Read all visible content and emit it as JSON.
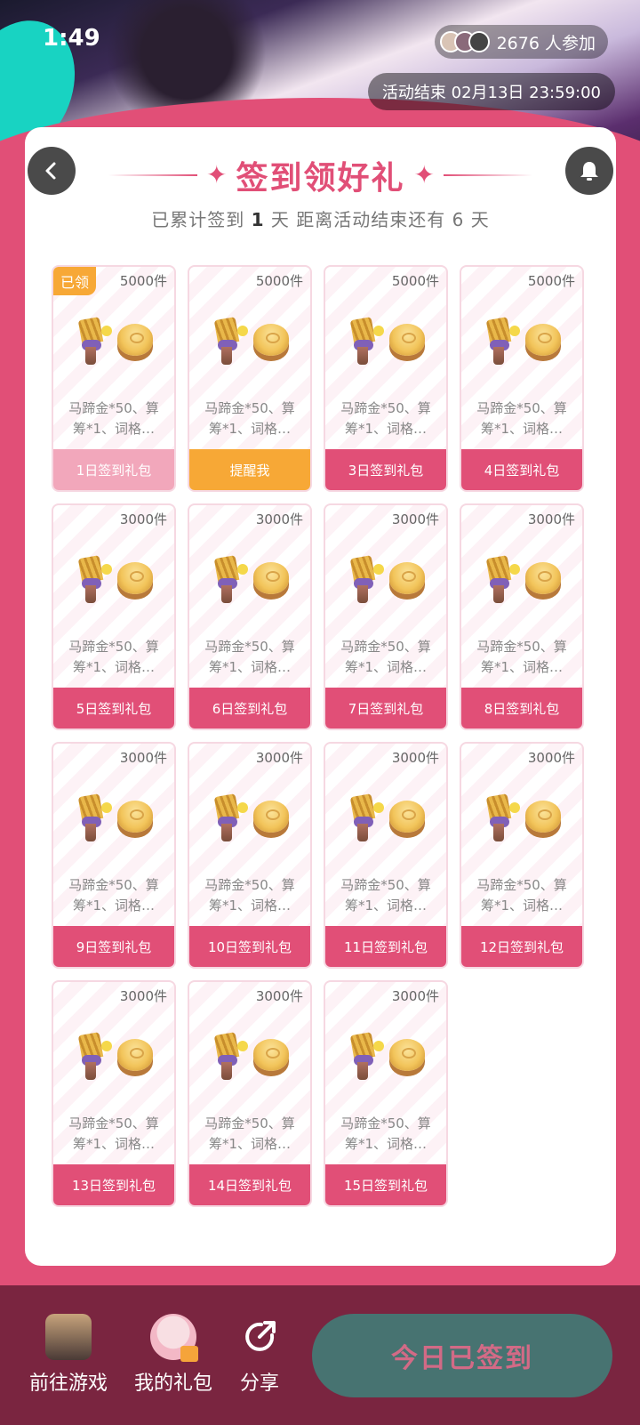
{
  "status": {
    "time": "1:49"
  },
  "header": {
    "participants": "2676 人参加",
    "deadline": "活动结束 02月13日 23:59:00"
  },
  "card": {
    "title": "签到领好礼",
    "summary_prefix": "已累计签到",
    "summary_days": "1",
    "summary_mid": "天  距离活动结束还有 6 天"
  },
  "gifts": [
    {
      "stock": "5000件",
      "desc": "马蹄金*50、算筹*1、词格…",
      "button": "1日签到礼包",
      "tag": "已领",
      "state": "claimed"
    },
    {
      "stock": "5000件",
      "desc": "马蹄金*50、算筹*1、词格…",
      "button": "提醒我",
      "state": "remind"
    },
    {
      "stock": "5000件",
      "desc": "马蹄金*50、算筹*1、词格…",
      "button": "3日签到礼包",
      "state": "normal"
    },
    {
      "stock": "5000件",
      "desc": "马蹄金*50、算筹*1、词格…",
      "button": "4日签到礼包",
      "state": "normal"
    },
    {
      "stock": "3000件",
      "desc": "马蹄金*50、算筹*1、词格…",
      "button": "5日签到礼包",
      "state": "normal"
    },
    {
      "stock": "3000件",
      "desc": "马蹄金*50、算筹*1、词格…",
      "button": "6日签到礼包",
      "state": "normal"
    },
    {
      "stock": "3000件",
      "desc": "马蹄金*50、算筹*1、词格…",
      "button": "7日签到礼包",
      "state": "normal"
    },
    {
      "stock": "3000件",
      "desc": "马蹄金*50、算筹*1、词格…",
      "button": "8日签到礼包",
      "state": "normal"
    },
    {
      "stock": "3000件",
      "desc": "马蹄金*50、算筹*1、词格…",
      "button": "9日签到礼包",
      "state": "normal"
    },
    {
      "stock": "3000件",
      "desc": "马蹄金*50、算筹*1、词格…",
      "button": "10日签到礼包",
      "state": "normal"
    },
    {
      "stock": "3000件",
      "desc": "马蹄金*50、算筹*1、词格…",
      "button": "11日签到礼包",
      "state": "normal"
    },
    {
      "stock": "3000件",
      "desc": "马蹄金*50、算筹*1、词格…",
      "button": "12日签到礼包",
      "state": "normal"
    },
    {
      "stock": "3000件",
      "desc": "马蹄金*50、算筹*1、词格…",
      "button": "13日签到礼包",
      "state": "normal"
    },
    {
      "stock": "3000件",
      "desc": "马蹄金*50、算筹*1、词格…",
      "button": "14日签到礼包",
      "state": "normal"
    },
    {
      "stock": "3000件",
      "desc": "马蹄金*50、算筹*1、词格…",
      "button": "15日签到礼包",
      "state": "normal"
    }
  ],
  "bottom": {
    "go_game": "前往游戏",
    "my_gifts": "我的礼包",
    "share": "分享",
    "cta": "今日已签到"
  },
  "colors": {
    "accent": "#e14f77",
    "remind": "#f7a836",
    "cta_bg": "#477371",
    "bar_bg": "#7a2540"
  }
}
